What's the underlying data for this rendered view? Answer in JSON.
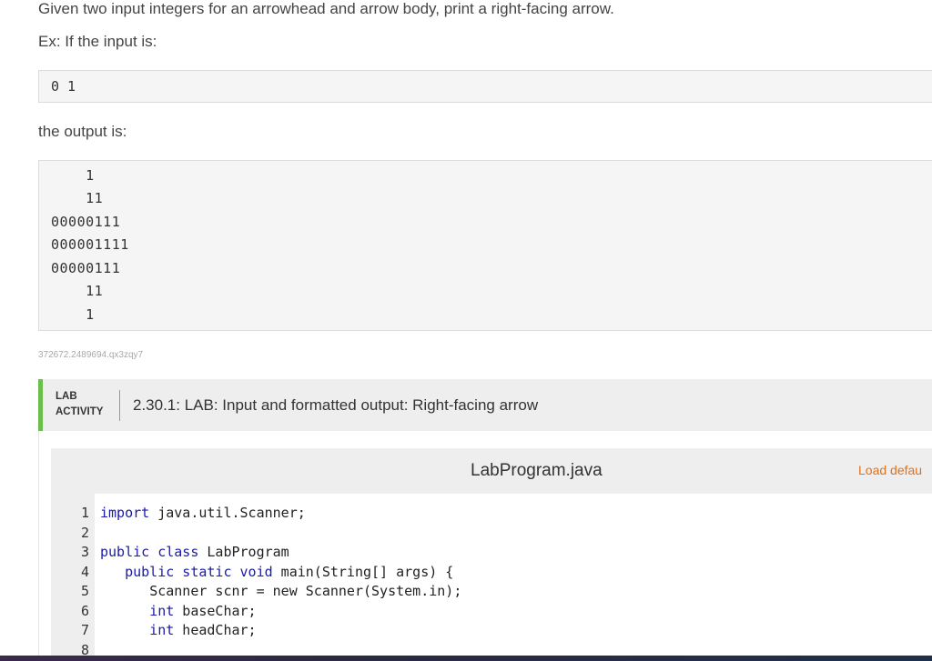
{
  "problem": {
    "prompt": "Given two input integers for an arrowhead and arrow body, print a right-facing arrow.",
    "example_label": "Ex: If the input is:",
    "input_example": "0 1",
    "output_label": "the output is:",
    "output_lines": [
      "    1",
      "    11",
      "00000111",
      "000001111",
      "00000111",
      "    11",
      "    1"
    ],
    "code_id": "372672.2489694.qx3zqy7"
  },
  "lab": {
    "tag_line1": "LAB",
    "tag_line2": "ACTIVITY",
    "title": "2.30.1: LAB: Input and formatted output: Right-facing arrow",
    "accent_color": "#6abf4b"
  },
  "editor": {
    "filename": "LabProgram.java",
    "load_default_label": "Load defau",
    "line_numbers": [
      "1",
      "2",
      "3",
      "4",
      "5",
      "6",
      "7",
      "8"
    ],
    "lines": [
      {
        "kw": "import",
        "rest": " java.util.Scanner;"
      },
      {
        "kw": "",
        "rest": ""
      },
      {
        "kw": "public class",
        "rest": " LabProgram"
      },
      {
        "indent": "   ",
        "kw": "public static void",
        "rest": " main(String[] args) {"
      },
      {
        "indent": "      ",
        "kw": "",
        "rest": "Scanner scnr = new Scanner(System.in);"
      },
      {
        "indent": "      ",
        "kw": "int",
        "rest": " baseChar;"
      },
      {
        "indent": "      ",
        "kw": "int",
        "rest": " headChar;"
      },
      {
        "kw": "",
        "rest": ""
      }
    ]
  }
}
